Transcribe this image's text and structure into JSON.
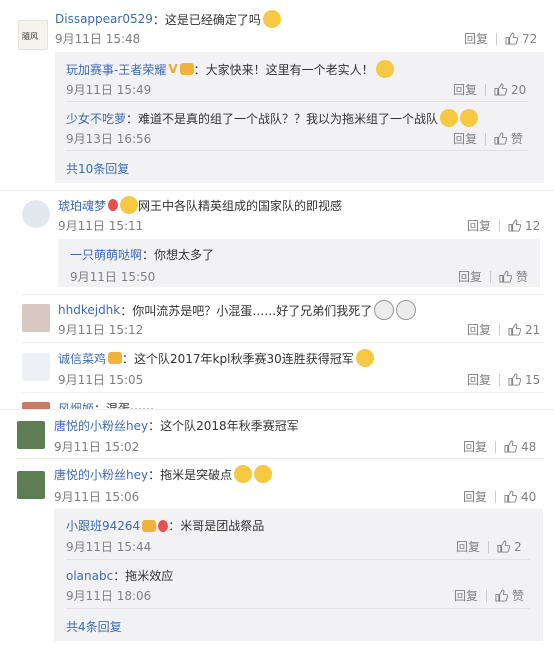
{
  "labels": {
    "reply": "回复"
  },
  "comments": [
    {
      "user": "Dissappear0529",
      "text": "：这是已经确定了吗",
      "time": "9月11日 15:48",
      "likes": "72"
    },
    {
      "user": "玩加赛事-王者荣耀",
      "text": "：大家快来！这里有一个老实人！",
      "time": "9月11日 15:49",
      "likes": "20"
    },
    {
      "user": "少女不吃萝",
      "text": "：难道不是真的组了一个战队？？我以为拖米组了一个战队",
      "time": "9月13日 16:56",
      "likes": "赞"
    },
    {
      "more": "共10条回复"
    },
    {
      "user": "琥珀魂梦",
      "text": "网王中各队精英组成的国家队的即视感",
      "time": "9月11日 15:11",
      "likes": "12"
    },
    {
      "user": "一只萌萌哒啊",
      "text": "：你想太多了",
      "time": "9月11日 15:50",
      "likes": "赞"
    },
    {
      "user": "hhdkejdhk",
      "text": "：你叫流苏是吧？小混蛋……好了兄弟们我死了",
      "time": "9月11日 15:12",
      "likes": "21"
    },
    {
      "user": "诚信菜鸡",
      "text": "：这个队2017年kpl秋季赛30连胜获得冠军",
      "time": "9月11日 15:05",
      "likes": "15"
    },
    {
      "user": "风烟姬",
      "text": "：混蛋⋯⋯",
      "time": "",
      "likes": ""
    },
    {
      "user": "唐悦的小粉丝hey",
      "text": "：这个队2018年秋季赛冠军",
      "time": "9月11日 15:02",
      "likes": "48"
    },
    {
      "user": "唐悦的小粉丝hey",
      "text": "：拖米是突破点",
      "time": "9月11日 15:06",
      "likes": "40"
    },
    {
      "user": "小跟班94264",
      "text": "：米哥是团战祭品",
      "time": "9月11日 15:44",
      "likes": "2"
    },
    {
      "user": "olanabc",
      "text": "：拖米效应",
      "time": "9月11日 18:06",
      "likes": "赞"
    },
    {
      "more": "共4条回复"
    }
  ],
  "colors": {
    "accent": "#eb7350",
    "link": "#3d6bb5",
    "muted": "#808080",
    "replyBg": "#f2f2f5"
  }
}
